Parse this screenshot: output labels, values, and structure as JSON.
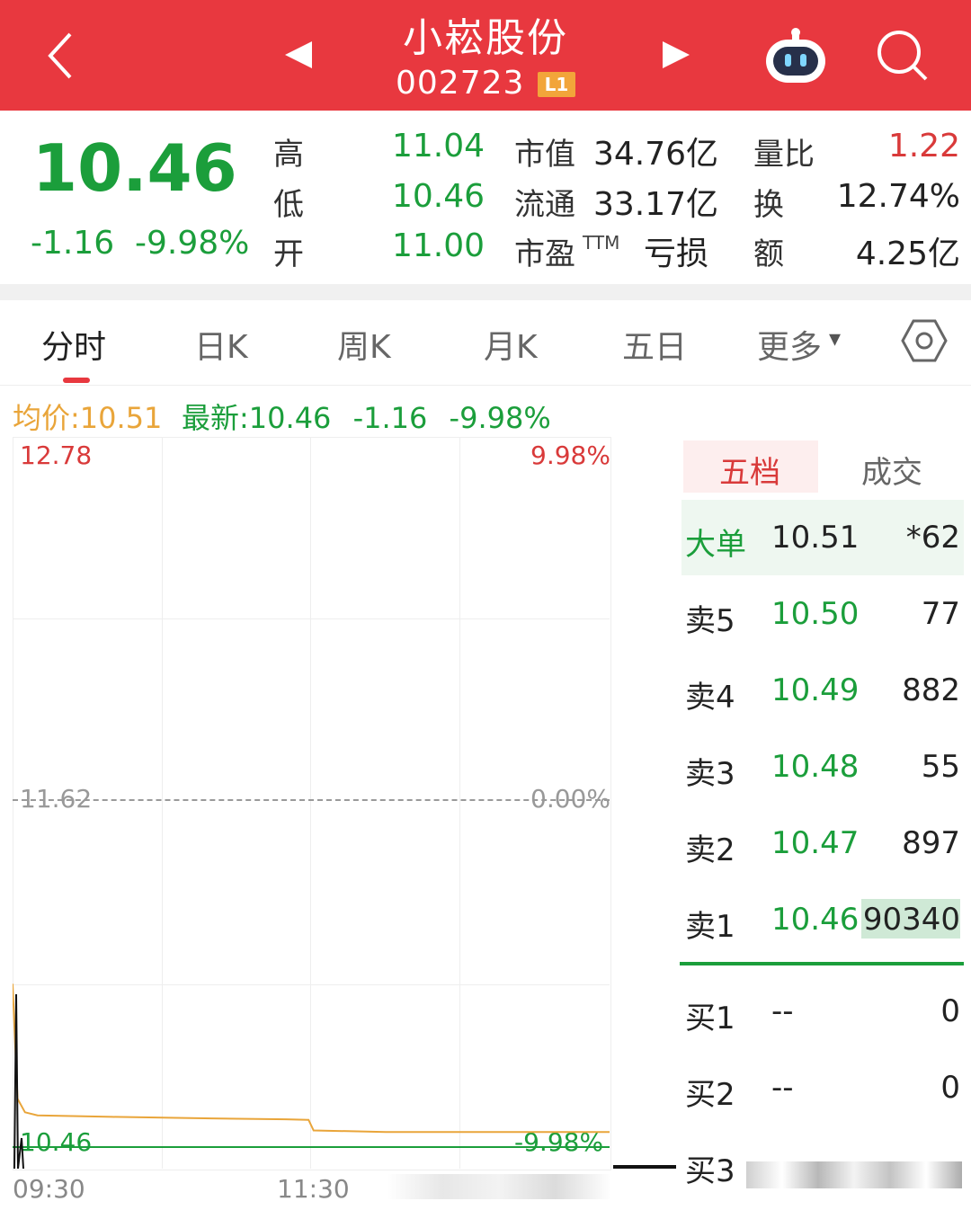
{
  "header": {
    "stock_name": "小崧股份",
    "stock_code": "002723",
    "badge": "L1",
    "back_icon": "chevron-left-icon",
    "prev_icon": "triangle-left-icon",
    "next_icon": "triangle-right-icon",
    "robot_icon": "robot-assistant-icon",
    "search_icon": "search-icon"
  },
  "quote": {
    "price": "10.46",
    "change": "-1.16",
    "change_pct": "-9.98%",
    "high_label": "高",
    "high": "11.04",
    "low_label": "低",
    "low": "10.46",
    "open_label": "开",
    "open": "11.00",
    "mktcap_label": "市值",
    "mktcap": "34.76亿",
    "float_label": "流通",
    "float": "33.17亿",
    "pe_label": "市盈",
    "pe_sup": "TTM",
    "pe": "亏损",
    "volratio_label": "量比",
    "volratio": "1.22",
    "turnover_label": "换",
    "turnover": "12.74%",
    "amount_label": "额",
    "amount": "4.25亿"
  },
  "tabs": [
    "分时",
    "日K",
    "周K",
    "月K",
    "五日",
    "更多"
  ],
  "tab_more_caret": "▾",
  "info_bar": {
    "avg_label": "均价:",
    "avg": "10.51",
    "latest_label": "最新:",
    "latest": "10.46",
    "change": "-1.16",
    "change_pct": "-9.98%"
  },
  "chart_data": {
    "type": "line",
    "y_top_label": "12.78",
    "y_mid_label": "11.62",
    "y_bottom_label": "10.46",
    "pct_top_label": "9.98%",
    "pct_mid_label": "0.00%",
    "pct_bottom_label": "-9.98%",
    "x_labels": [
      "09:30",
      "11:30"
    ],
    "ylim": [
      10.46,
      12.78
    ],
    "series": [
      {
        "color": "#1b9e3b",
        "x": [
          0,
          1,
          2,
          10,
          60,
          120,
          121,
          240
        ],
        "values": [
          10.46,
          10.46,
          10.46,
          10.46,
          10.46,
          10.46,
          10.46,
          10.46
        ]
      },
      {
        "color": "#e9a53a",
        "x": [
          0,
          2,
          5,
          10,
          40,
          80,
          110,
          119,
          121,
          150,
          200,
          240
        ],
        "values": [
          11.0,
          10.62,
          10.575,
          10.565,
          10.56,
          10.555,
          10.552,
          10.55,
          10.515,
          10.51,
          10.51,
          10.51
        ]
      }
    ],
    "volume_color": "#111111"
  },
  "orderbook": {
    "tab_five": "五档",
    "tab_trades": "成交",
    "big_label": "大单",
    "big_price": "10.51",
    "big_vol": "*62",
    "asks": [
      {
        "label": "卖5",
        "price": "10.50",
        "vol": "77"
      },
      {
        "label": "卖4",
        "price": "10.49",
        "vol": "882"
      },
      {
        "label": "卖3",
        "price": "10.48",
        "vol": "55"
      },
      {
        "label": "卖2",
        "price": "10.47",
        "vol": "897"
      },
      {
        "label": "卖1",
        "price": "10.46",
        "vol": "90340"
      }
    ],
    "bids": [
      {
        "label": "买1",
        "price": "--",
        "vol": "0"
      },
      {
        "label": "买2",
        "price": "--",
        "vol": "0"
      },
      {
        "label": "买3",
        "price": "",
        "vol": ""
      }
    ]
  },
  "settings_icon": "hexagon-settings-icon"
}
